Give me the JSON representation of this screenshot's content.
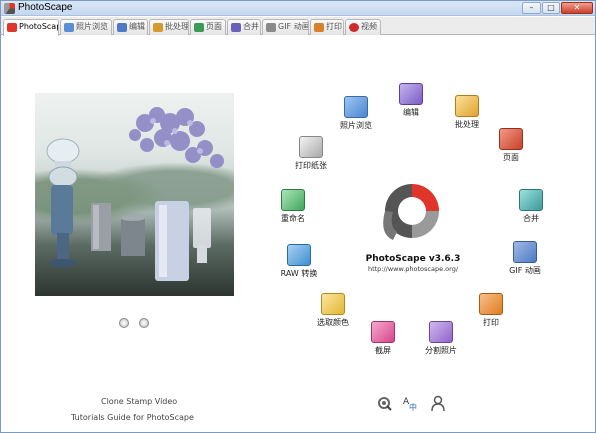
{
  "window": {
    "title": "PhotoScape",
    "buttons": {
      "minimize": "–",
      "maximize": "□",
      "close": "✕"
    }
  },
  "tabs": [
    {
      "label": "PhotoScape",
      "icon": "photoscape-logo-icon",
      "active": true,
      "color": "#e0352b"
    },
    {
      "label": "照片浏览",
      "icon": "photo-browser-icon",
      "color": "#5a8fd6"
    },
    {
      "label": "编辑",
      "icon": "editor-icon",
      "color": "#4f7bc4"
    },
    {
      "label": "批处理",
      "icon": "batch-icon",
      "color": "#d49b2c"
    },
    {
      "label": "页面",
      "icon": "page-icon",
      "color": "#3c9a55"
    },
    {
      "label": "合并",
      "icon": "combine-icon",
      "color": "#6a62b8"
    },
    {
      "label": "GIF 动画",
      "icon": "gif-animation-icon",
      "color": "#8a8a8a"
    },
    {
      "label": "打印",
      "icon": "print-icon",
      "color": "#d8802a"
    },
    {
      "label": "视频",
      "icon": "help-icon",
      "color": "#cf2b2b"
    }
  ],
  "preview": {
    "controls": [
      "previous-icon",
      "play-icon"
    ],
    "links": [
      "Clone Stamp Video",
      "Tutorials Guide for PhotoScape"
    ]
  },
  "logo": {
    "name": "PhotoScape v3.6.3",
    "url": "http://www.photoscape.org/"
  },
  "menu": [
    {
      "label": "照片浏览",
      "icon": "photo-browser-icon",
      "color": "#4b86d0"
    },
    {
      "label": "编辑",
      "icon": "editor-icon",
      "color": "#7c5cc4"
    },
    {
      "label": "批处理",
      "icon": "batch-icon",
      "color": "#e0a22f"
    },
    {
      "label": "页面",
      "icon": "page-icon",
      "color": "#c8402a"
    },
    {
      "label": "合并",
      "icon": "combine-icon",
      "color": "#3a9a9a"
    },
    {
      "label": "GIF 动画",
      "icon": "gif-animation-icon",
      "color": "#4f7bc4"
    },
    {
      "label": "打印",
      "icon": "print-icon",
      "color": "#e07c22"
    },
    {
      "label": "分割照片",
      "icon": "splitter-icon",
      "color": "#8f63c8"
    },
    {
      "label": "截屏",
      "icon": "screen-capture-icon",
      "color": "#d6468c"
    },
    {
      "label": "选取颜色",
      "icon": "color-picker-icon",
      "color": "#e2b634"
    },
    {
      "label": "RAW 转换",
      "icon": "raw-converter-icon",
      "color": "#3f8fd0"
    },
    {
      "label": "重命名",
      "icon": "rename-icon",
      "color": "#42a65c"
    },
    {
      "label": "打印纸张",
      "icon": "paper-print-icon",
      "color": "#a8a8a8"
    }
  ],
  "bottom_icons": [
    "settings-icon",
    "language-icon",
    "help-person-icon"
  ]
}
